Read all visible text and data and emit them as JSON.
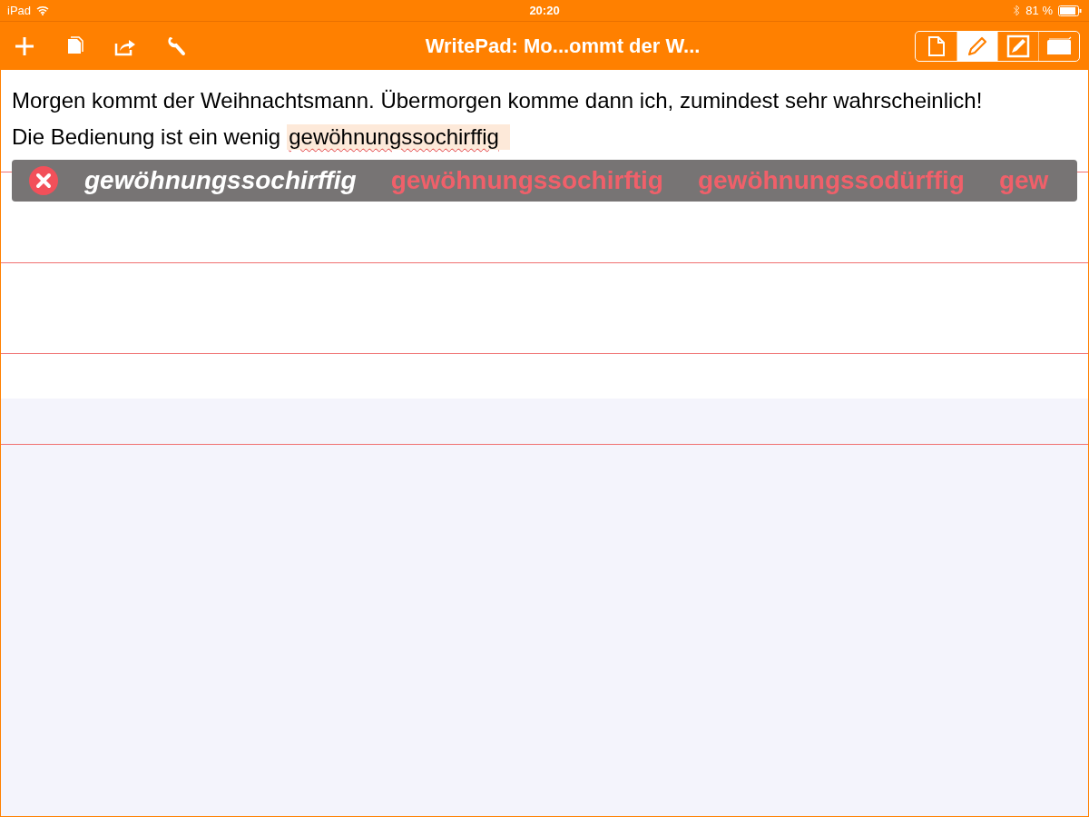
{
  "status_bar": {
    "carrier": "iPad",
    "time": "20:20",
    "battery": "81 %"
  },
  "toolbar": {
    "title": "WritePad: Mo...ommt der W...",
    "actions": [
      {
        "kind": "plus"
      },
      {
        "kind": "documents"
      },
      {
        "kind": "share"
      },
      {
        "kind": "wrench"
      }
    ],
    "modes": [
      {
        "kind": "page",
        "selected": false
      },
      {
        "kind": "pen",
        "selected": true
      },
      {
        "kind": "edit",
        "selected": false
      },
      {
        "kind": "folder",
        "selected": false
      }
    ]
  },
  "document": {
    "lines": [
      {
        "text": "Morgen kommt der Weihnachtsmann. Übermorgen komme dann ich, zumindest sehr wahrscheinlich!"
      },
      {
        "text": "Die Bedienung ist ein wenig",
        "marked_word": "gewöhnungssochirffig"
      }
    ]
  },
  "suggestions": {
    "original": "gewöhnungssochirffig",
    "alternatives": [
      "gewöhnungssochirftig",
      "gewöhnungssodürffig",
      "gew"
    ]
  }
}
